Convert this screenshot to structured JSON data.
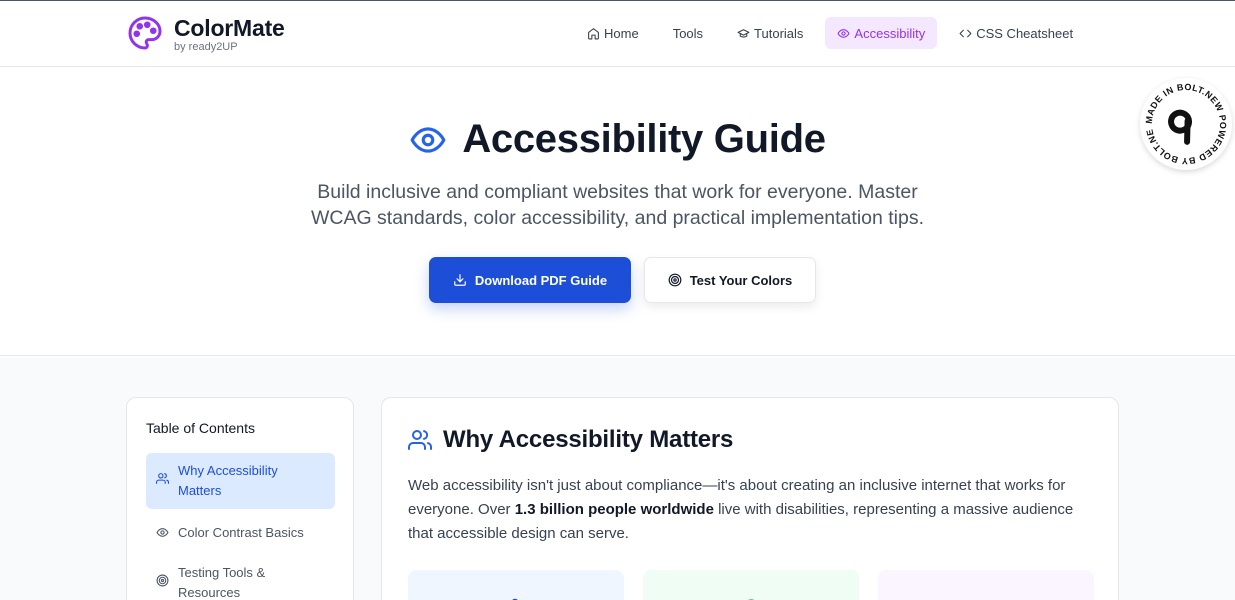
{
  "brand": {
    "name": "ColorMate",
    "tagline": "by ready2UP"
  },
  "nav": {
    "items": [
      {
        "label": "Home",
        "icon": "home-icon"
      },
      {
        "label": "Tools",
        "icon": ""
      },
      {
        "label": "Tutorials",
        "icon": "graduation-cap-icon"
      },
      {
        "label": "Accessibility",
        "icon": "eye-icon",
        "active": true
      },
      {
        "label": "CSS Cheatsheet",
        "icon": "code-icon"
      }
    ]
  },
  "hero": {
    "title": "Accessibility Guide",
    "description_line1": "Build inclusive and compliant websites that work for everyone. Master",
    "description_line2": "WCAG standards, color accessibility, and practical implementation tips.",
    "primary_button": "Download PDF Guide",
    "secondary_button": "Test Your Colors"
  },
  "badge": {
    "text": "MADE IN BOLT.NEW POWERED BY BOLT.NEW"
  },
  "toc": {
    "heading": "Table of Contents",
    "items": [
      {
        "line1": "Why Accessibility",
        "line2": "Matters",
        "icon": "users-icon"
      },
      {
        "line1": "Color Contrast Basics",
        "line2": "",
        "icon": "eye-icon"
      },
      {
        "line1": "Testing Tools &",
        "line2": "Resources",
        "icon": "target-icon"
      }
    ]
  },
  "section": {
    "title": "Why Accessibility Matters",
    "text_before": "Web accessibility isn't just about compliance—it's about creating an inclusive internet that works for everyone. Over ",
    "text_bold": "1.3 billion people worldwide",
    "text_after": " live with disabilities, representing a massive audience that accessible design can serve."
  },
  "colors": {
    "accent": "#9333ea",
    "primary": "#1d4ed8",
    "toc_active_bg": "#dbeafe",
    "nav_active_bg": "#f3e8ff"
  }
}
